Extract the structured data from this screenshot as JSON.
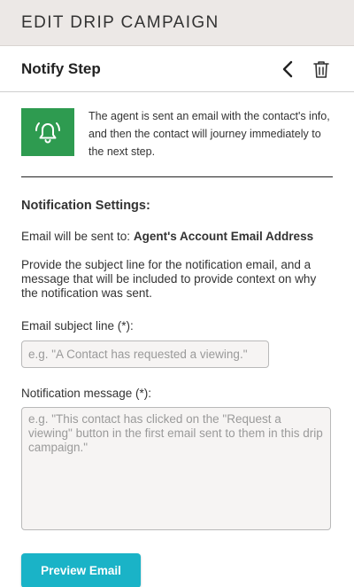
{
  "header": {
    "title": "EDIT DRIP CAMPAIGN"
  },
  "step": {
    "title": "Notify Step",
    "back_icon": "chevron-left-icon",
    "delete_icon": "trash-icon"
  },
  "info": {
    "icon": "bell-alert-icon",
    "icon_bg": "#2e9b50",
    "text": "The agent is sent an email with the contact's info, and then the contact will journey immediately to the next step."
  },
  "settings": {
    "title": "Notification Settings:",
    "recipient_prefix": "Email will be sent to:",
    "recipient_value": "Agent's Account Email Address",
    "help": "Provide the subject line for the notification email, and a message that will be included to provide context on why the notification was sent.",
    "subject_label": "Email subject line (*):",
    "subject_placeholder": "e.g. \"A Contact has requested a viewing.\"",
    "subject_value": "",
    "message_label": "Notification message (*):",
    "message_placeholder": "e.g. \"This contact has clicked on the \"Request a viewing\" button in the first email sent to them in this drip campaign.\"",
    "message_value": ""
  },
  "actions": {
    "preview_label": "Preview Email",
    "preview_color": "#1ab3c7"
  }
}
